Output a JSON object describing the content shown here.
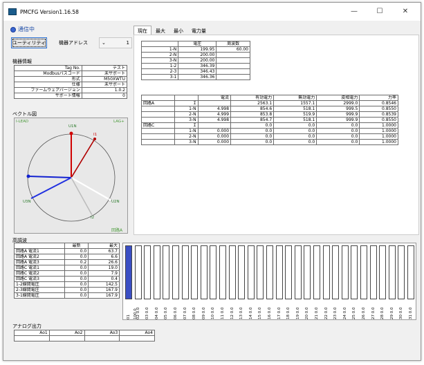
{
  "window": {
    "title": "PMCFG Version1.16.58",
    "min": "—",
    "max": "☐",
    "close": "✕"
  },
  "status": {
    "label": "通信中",
    "color": "#3a66d0"
  },
  "toolbar": {
    "utility": "ユーティリティ",
    "address_label": "機器アドレス",
    "address_value": "1",
    "dropdown_icon": "⌄"
  },
  "device": {
    "title": "機器情報",
    "rows": [
      {
        "k": "Tag No.",
        "v": "テスト"
      },
      {
        "k": "Modbusパスコード",
        "v": "未サポート"
      },
      {
        "k": "形式",
        "v": "M50XWTU"
      },
      {
        "k": "仕様",
        "v": "未サポート"
      },
      {
        "k": "ファームウェアバージョン",
        "v": "1.0.2"
      },
      {
        "k": "サポート情報",
        "v": "0"
      }
    ]
  },
  "vector": {
    "title": "ベクトル図",
    "lead": "I-LEAD",
    "lag": "LAG+",
    "u1n": "U1N",
    "u2n": "U2N",
    "u3n": "U3N",
    "i1": "I1",
    "i2": "I2",
    "circuit": "回路A"
  },
  "tabs": [
    "現在",
    "最大",
    "最小",
    "電力量"
  ],
  "voltage": {
    "headers": [
      "電圧",
      "周波数"
    ],
    "rows": [
      {
        "name": "1-N",
        "v": "199.95",
        "f": "60.00"
      },
      {
        "name": "2-N",
        "v": "200.00",
        "f": ""
      },
      {
        "name": "3-N",
        "v": "200.00",
        "f": ""
      },
      {
        "name": "1-2",
        "v": "346.39",
        "f": ""
      },
      {
        "name": "2-3",
        "v": "346.43",
        "f": ""
      },
      {
        "name": "3-1",
        "v": "346.36",
        "f": ""
      }
    ]
  },
  "power": {
    "headers": [
      "電流",
      "有効電力",
      "無効電力",
      "皮相電力",
      "力率"
    ],
    "rows": [
      {
        "c": "回路A",
        "p": "Σ",
        "v": [
          "",
          "2563.1",
          "1557.1",
          "2999.0",
          "0.8546"
        ]
      },
      {
        "c": "",
        "p": "1-N",
        "v": [
          "4.998",
          "854.6",
          "518.1",
          "999.5",
          "0.8550"
        ]
      },
      {
        "c": "",
        "p": "2-N",
        "v": [
          "4.999",
          "853.8",
          "519.9",
          "999.9",
          "0.8539"
        ]
      },
      {
        "c": "",
        "p": "3-N",
        "v": [
          "4.998",
          "854.7",
          "518.1",
          "999.9",
          "0.8550"
        ]
      },
      {
        "c": "回路C",
        "p": "Σ",
        "v": [
          "",
          "0.0",
          "0.0",
          "0.0",
          "1.0000"
        ]
      },
      {
        "c": "",
        "p": "1-N",
        "v": [
          "0.000",
          "0.0",
          "0.0",
          "0.0",
          "1.0000"
        ]
      },
      {
        "c": "",
        "p": "2-N",
        "v": [
          "0.000",
          "0.0",
          "0.0",
          "0.0",
          "1.0000"
        ]
      },
      {
        "c": "",
        "p": "3-N",
        "v": [
          "0.000",
          "0.0",
          "0.0",
          "0.0",
          "1.0000"
        ]
      }
    ]
  },
  "harmonics": {
    "title": "高調波",
    "headers": [
      "最新",
      "最大"
    ],
    "rows": [
      {
        "k": "回路A 電流1",
        "a": "0.0",
        "b": "63.7"
      },
      {
        "k": "回路A 電流2",
        "a": "0.0",
        "b": "6.6"
      },
      {
        "k": "回路A 電流3",
        "a": "0.2",
        "b": "26.6"
      },
      {
        "k": "回路C 電流1",
        "a": "0.0",
        "b": "19.0"
      },
      {
        "k": "回路C 電流2",
        "a": "0.0",
        "b": "7.9"
      },
      {
        "k": "回路C 電流3",
        "a": "0.0",
        "b": "0.4"
      },
      {
        "k": "1-2線間電圧",
        "a": "0.0",
        "b": "142.5"
      },
      {
        "k": "2-3線間電圧",
        "a": "0.0",
        "b": "167.9"
      },
      {
        "k": "3-1線間電圧",
        "a": "0.0",
        "b": "167.9"
      }
    ],
    "bars": [
      "01 100.0",
      "02 0.0",
      "03 0.0",
      "04 0.0",
      "05 0.0",
      "06 0.0",
      "07 0.0",
      "08 0.0",
      "09 0.0",
      "10 0.0",
      "11 0.0",
      "12 0.0",
      "13 0.0",
      "14 0.0",
      "15 0.0",
      "16 0.0",
      "17 0.0",
      "18 0.0",
      "19 0.0",
      "20 0.0",
      "21 0.0",
      "22 0.0",
      "23 0.0",
      "24 0.0",
      "25 0.0",
      "26 0.0",
      "27 0.0",
      "28 0.0",
      "29 0.0",
      "30 0.0",
      "31 0.0"
    ],
    "bar_levels": [
      1,
      0,
      0,
      0,
      0,
      0,
      0,
      0,
      0,
      0,
      0,
      0,
      0,
      0,
      0,
      0,
      0,
      0,
      0,
      0,
      0,
      0,
      0,
      0,
      0,
      0,
      0,
      0,
      0,
      0,
      0
    ],
    "bar_color": "#3b4fc4"
  },
  "analog": {
    "title": "アナログ出力",
    "cols": [
      "Ao1",
      "Ao2",
      "Ao3",
      "Ao4"
    ]
  }
}
